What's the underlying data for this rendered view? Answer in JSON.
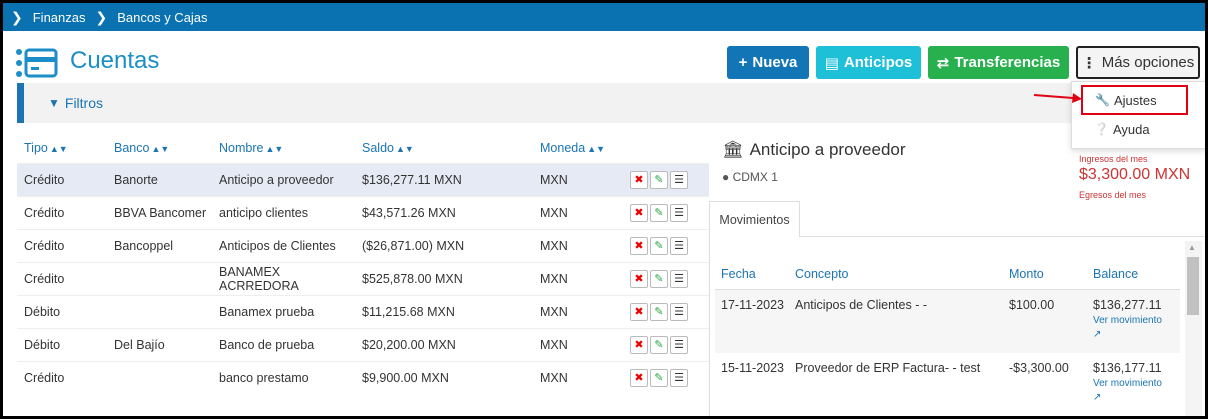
{
  "breadcrumb": {
    "items": [
      "Finanzas",
      "Bancos y Cajas"
    ]
  },
  "page": {
    "title": "Cuentas"
  },
  "toolbar": {
    "nueva": "Nueva",
    "anticipos": "Anticipos",
    "transferencias": "Transferencias",
    "mas_opciones": "Más opciones"
  },
  "filters": {
    "label": "Filtros"
  },
  "dropdown": {
    "items": [
      "Ajustes",
      "Ayuda"
    ]
  },
  "accounts": {
    "headers": [
      "Tipo",
      "Banco",
      "Nombre",
      "Saldo",
      "Moneda"
    ],
    "rows": [
      {
        "tipo": "Crédito",
        "banco": "Banorte",
        "nombre": "Anticipo a proveedor",
        "saldo": "$136,277.11 MXN",
        "moneda": "MXN"
      },
      {
        "tipo": "Crédito",
        "banco": "BBVA Bancomer",
        "nombre": "anticipo clientes",
        "saldo": "$43,571.26 MXN",
        "moneda": "MXN"
      },
      {
        "tipo": "Crédito",
        "banco": "Bancoppel",
        "nombre": "Anticipos de Clientes",
        "saldo": "($26,871.00) MXN",
        "moneda": "MXN"
      },
      {
        "tipo": "Crédito",
        "banco": "",
        "nombre": "BANAMEX ACRREDORA",
        "saldo": "$525,878.00 MXN",
        "moneda": "MXN"
      },
      {
        "tipo": "Débito",
        "banco": "",
        "nombre": "Banamex prueba",
        "saldo": "$11,215.68 MXN",
        "moneda": "MXN"
      },
      {
        "tipo": "Débito",
        "banco": "Del Bajío",
        "nombre": "Banco de prueba",
        "saldo": "$20,200.00 MXN",
        "moneda": "MXN"
      },
      {
        "tipo": "Crédito",
        "banco": "",
        "nombre": "banco prestamo",
        "saldo": "$9,900.00 MXN",
        "moneda": "MXN"
      }
    ]
  },
  "detail": {
    "title": "Anticipo a proveedor",
    "location": "CDMX 1",
    "ingresos_label": "Ingresos del mes",
    "ingresos_value": "$3,300.00 MXN",
    "egresos_label": "Egresos del mes",
    "tab": "Movimientos",
    "movements": {
      "headers": [
        "Fecha",
        "Concepto",
        "Monto",
        "Balance"
      ],
      "link_label": "Ver movimiento",
      "rows": [
        {
          "fecha": "17-11-2023",
          "concepto": "Anticipos de Clientes - -",
          "monto": "$100.00",
          "balance": "$136,277.11"
        },
        {
          "fecha": "15-11-2023",
          "concepto": "Proveedor de ERP Factura- - test",
          "monto": "-$3,300.00",
          "balance": "$136,177.11"
        }
      ]
    }
  },
  "colors": {
    "topbar": "#0a72b0",
    "primary": "#1175b6",
    "info": "#1ec0d8",
    "success": "#28b04e",
    "danger": "#e00012",
    "title": "#1b8ec9"
  },
  "icons": [
    "chevron-right-icon",
    "card-list-icon",
    "plus-icon",
    "money-icon",
    "exchange-icon",
    "vertical-dots-icon",
    "filter-icon",
    "wrench-icon",
    "question-circle-icon",
    "sort-icon",
    "delete-icon",
    "edit-icon",
    "menu-icon",
    "bank-icon",
    "map-marker-icon",
    "external-link-icon"
  ]
}
